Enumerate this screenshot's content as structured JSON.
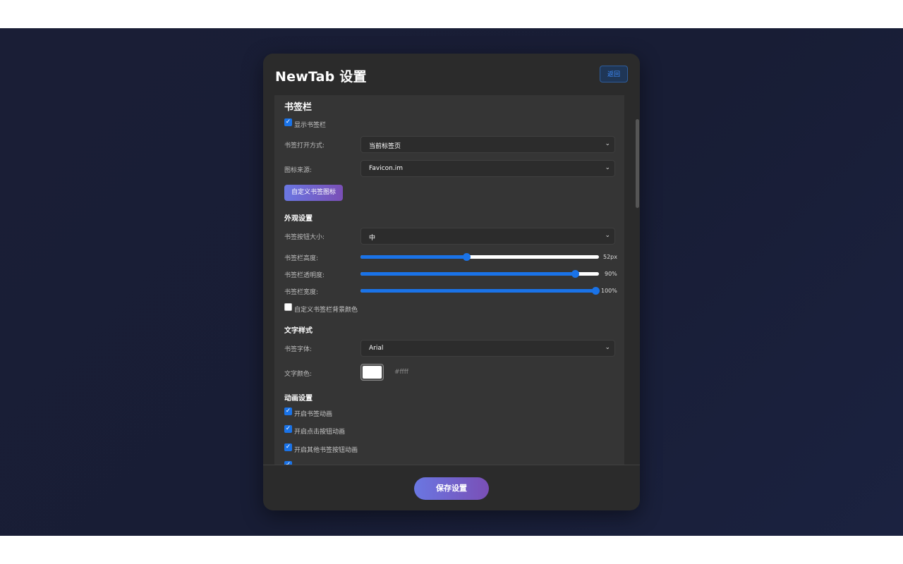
{
  "title": "NewTab 设置",
  "back_label": "返回",
  "save_label": "保存设置",
  "bookmark_bar": {
    "title": "书签栏",
    "show_bar": {
      "label": "显示书签栏",
      "checked": true
    },
    "open_mode": {
      "label": "书签打开方式:",
      "value": "当前标签页"
    },
    "icon_source": {
      "label": "图标来源:",
      "value": "Favicon.im"
    },
    "custom_icons_button": "自定义书签图标"
  },
  "appearance": {
    "title": "外观设置",
    "button_size": {
      "label": "书签按钮大小:",
      "value": "中"
    },
    "bar_height": {
      "label": "书签栏高度:",
      "display": "52px",
      "fraction": 0.445
    },
    "bar_opacity": {
      "label": "书签栏透明度:",
      "display": "90%",
      "fraction": 0.9
    },
    "bar_width": {
      "label": "书签栏宽度:",
      "display": "100%",
      "fraction": 1.0
    },
    "custom_bg": {
      "label": "自定义书签栏背景颜色",
      "checked": false
    }
  },
  "text_style": {
    "title": "文字样式",
    "font": {
      "label": "书签字体:",
      "value": "Arial"
    },
    "color": {
      "label": "文字颜色:",
      "value": "#ffffff",
      "display": "#ffff"
    }
  },
  "animation": {
    "title": "动画设置",
    "items": [
      {
        "label": "开启书签动画",
        "checked": true
      },
      {
        "label": "开启点击按钮动画",
        "checked": true
      },
      {
        "label": "开启其他书签按钮动画",
        "checked": true
      },
      {
        "label": "",
        "checked": true
      }
    ]
  },
  "colors": {
    "accent": "#1a73e8",
    "gradient_start": "#6a77e2",
    "gradient_end": "#7a4fb6"
  }
}
